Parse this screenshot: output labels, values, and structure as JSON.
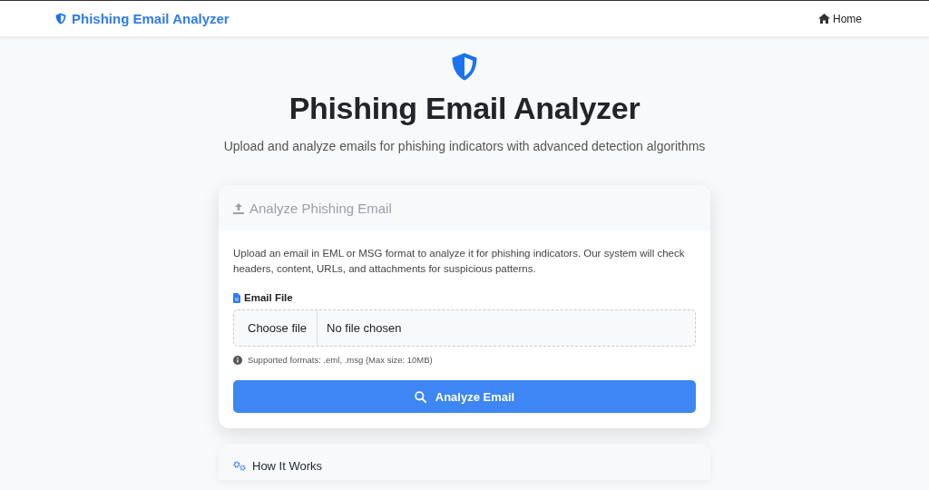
{
  "navbar": {
    "brand": "Phishing Email Analyzer",
    "links": [
      {
        "label": "Home"
      }
    ]
  },
  "hero": {
    "title": "Phishing Email Analyzer",
    "subtitle": "Upload and analyze emails for phishing indicators with advanced detection algorithms"
  },
  "upload_card": {
    "header": "Analyze Phishing Email",
    "description": "Upload an email in EML or MSG format to analyze it for phishing indicators. Our system will check headers, content, URLs, and attachments for suspicious patterns.",
    "field_label": "Email File",
    "choose_button": "Choose file",
    "file_status": "No file chosen",
    "help": "Supported formats: .eml, .msg (Max size: 10MB)",
    "submit": "Analyze Email"
  },
  "info_card": {
    "title": "How It Works"
  }
}
